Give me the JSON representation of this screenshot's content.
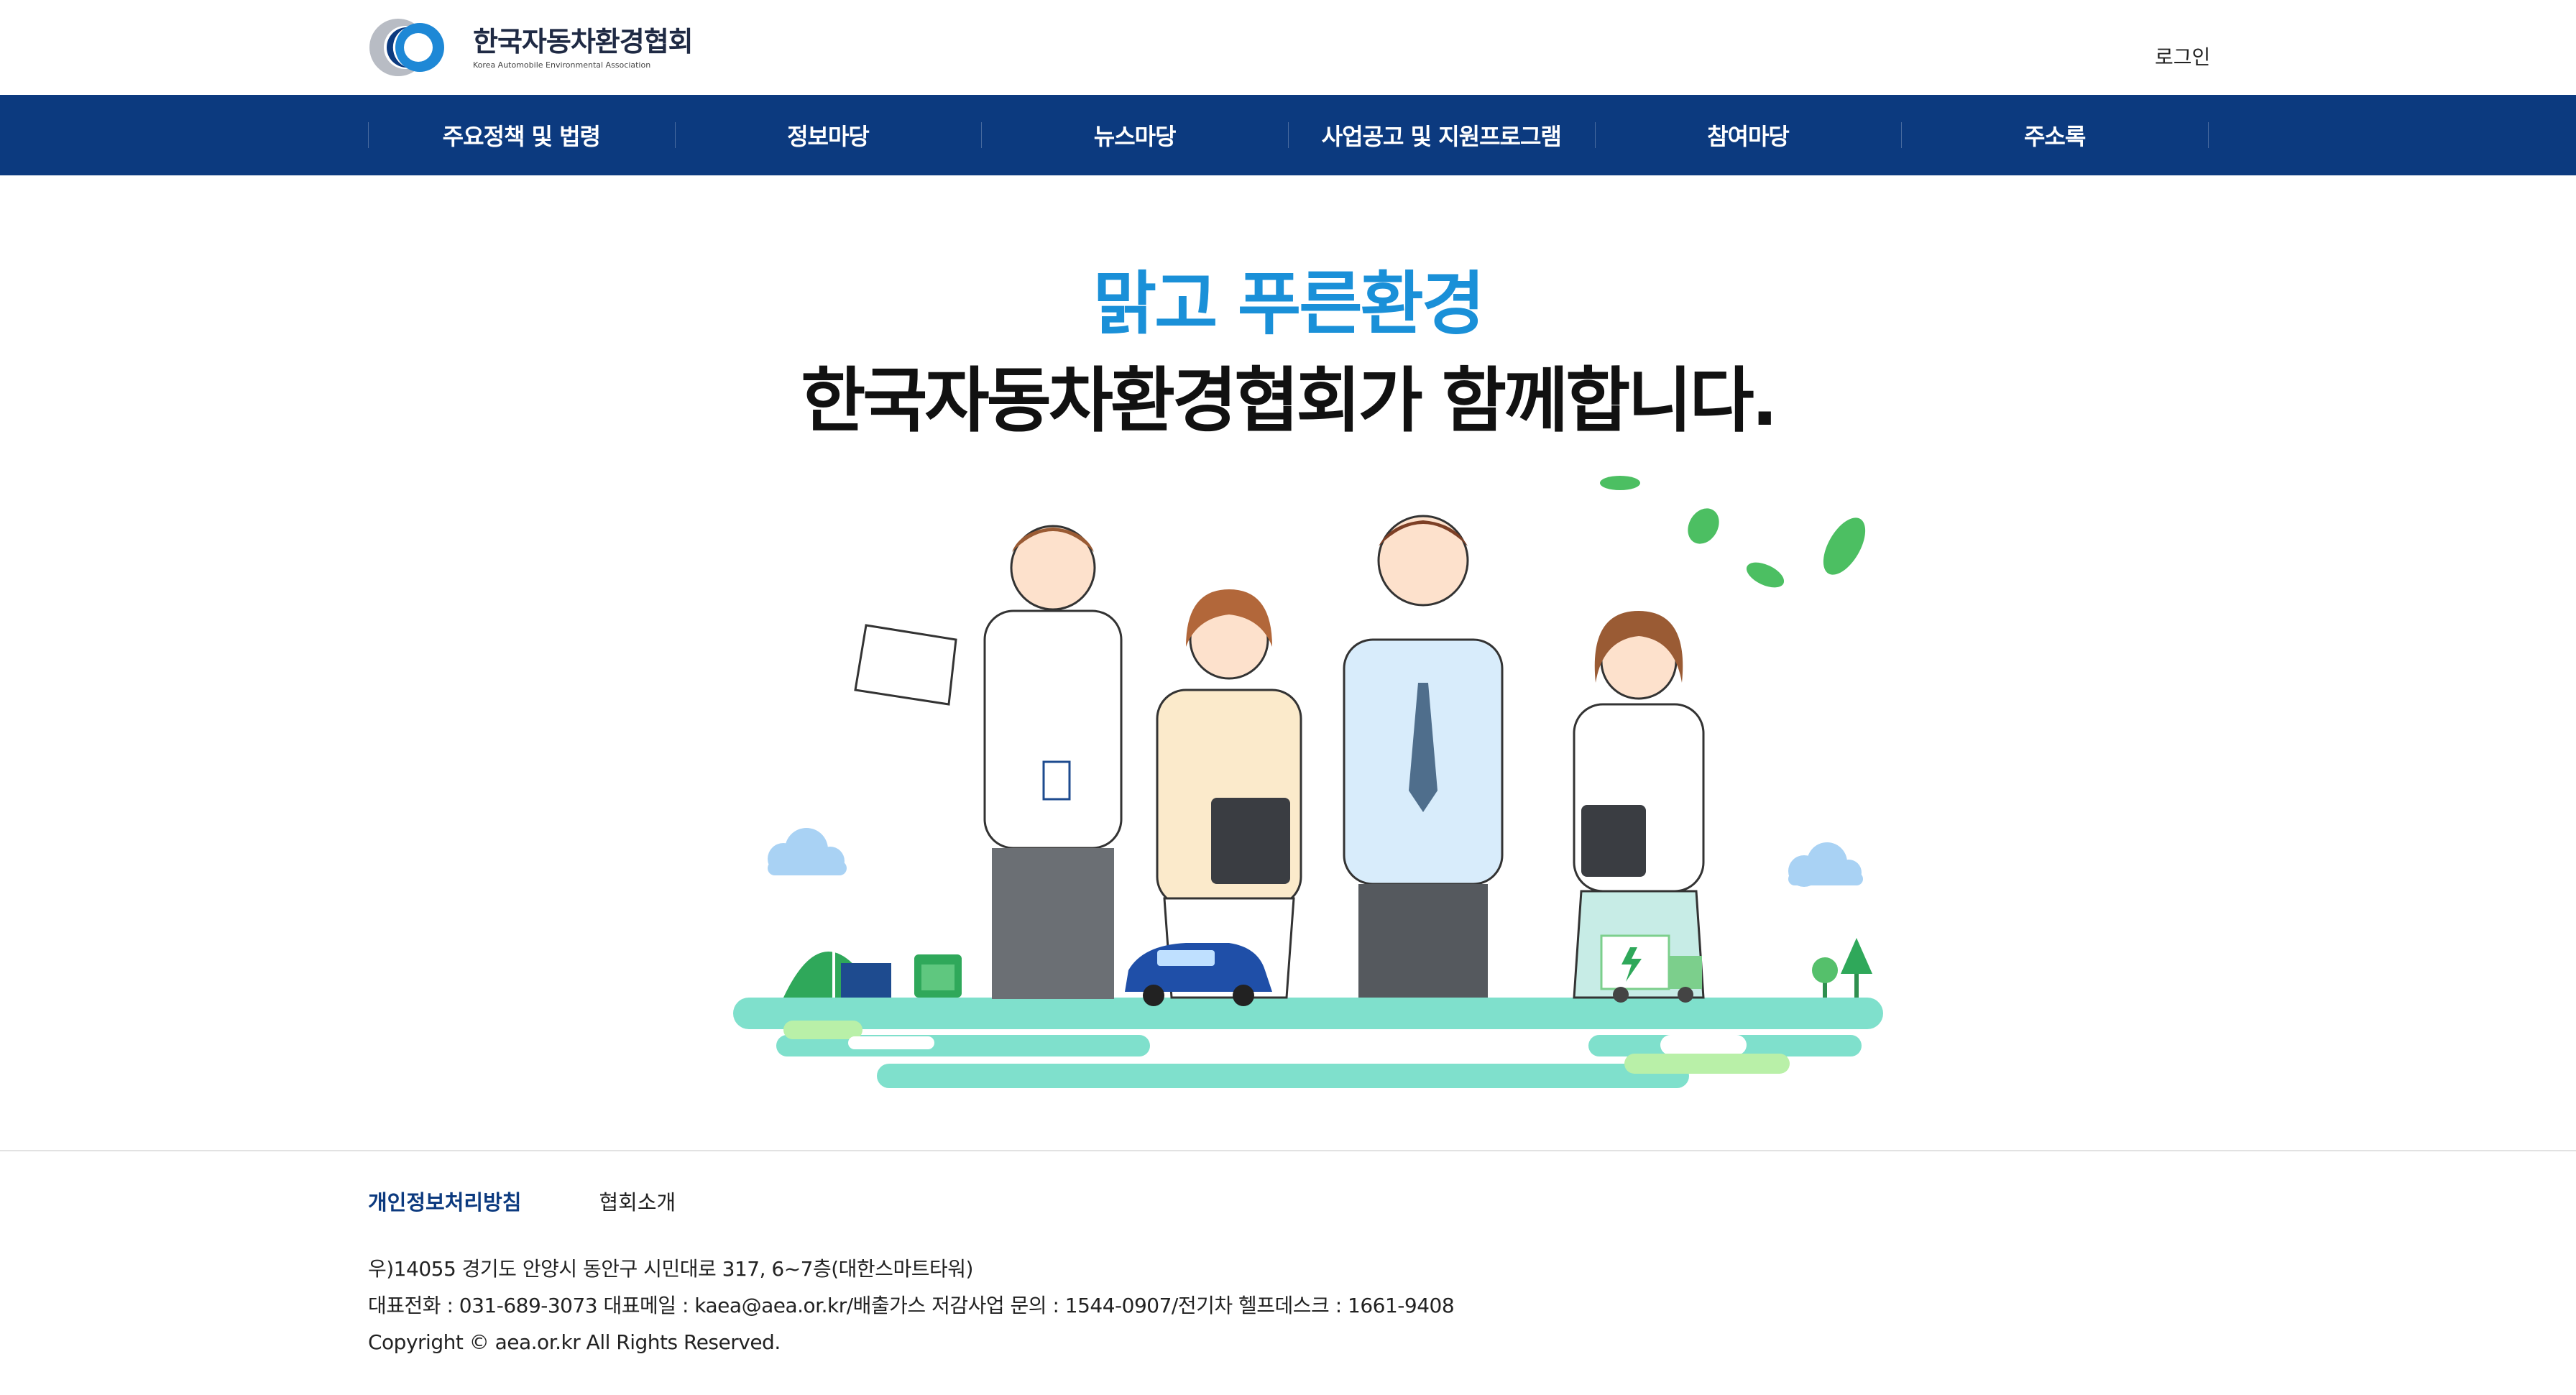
{
  "header": {
    "logo_ko": "한국자동차환경협회",
    "logo_en": "Korea Automobile Environmental Association",
    "login_label": "로그인"
  },
  "nav": {
    "items": [
      {
        "label": "주요정책 및 법령"
      },
      {
        "label": "정보마당"
      },
      {
        "label": "뉴스마당"
      },
      {
        "label": "사업공고 및 지원프로그램"
      },
      {
        "label": "참여마당"
      },
      {
        "label": "주소록"
      }
    ]
  },
  "hero": {
    "subtitle": "맑고 푸른환경",
    "title": "한국자동차환경협회가 함께합니다."
  },
  "footer": {
    "links": [
      {
        "label": "개인정보처리방침"
      },
      {
        "label": "협회소개"
      }
    ],
    "address": "우)14055 경기도 안양시 동안구 시민대로 317, 6~7층(대한스마트타워)",
    "contact": "대표전화 : 031-689-3073 대표메일 : kaea@aea.or.kr/배출가스 저감사업 문의 : 1544-0907/전기차 헬프데스크 : 1661-9408",
    "copyright": "Copyright © aea.or.kr All Rights Reserved."
  },
  "colors": {
    "nav_bg": "#0c3a7f",
    "hero_subtitle": "#1a90d8",
    "ground": "#7fe0cc"
  }
}
